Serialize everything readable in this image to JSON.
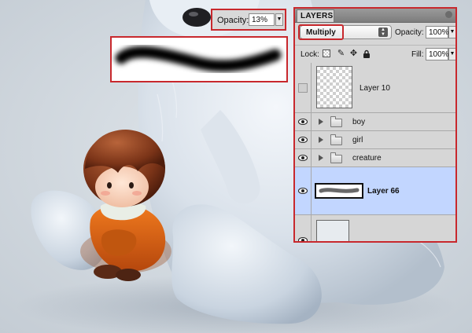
{
  "tool_options": {
    "opacity_label": "Opacity:",
    "opacity_value": "13%"
  },
  "layers_panel": {
    "tab_label": "LAYERS",
    "blend_mode": "Multiply",
    "opacity_label": "Opacity:",
    "opacity_value": "100%",
    "lock_label": "Lock:",
    "fill_label": "Fill:",
    "fill_value": "100%",
    "layers": [
      {
        "name": "Layer 10",
        "type": "layer",
        "visible": false
      },
      {
        "name": "boy",
        "type": "group",
        "visible": true
      },
      {
        "name": "girl",
        "type": "group",
        "visible": true
      },
      {
        "name": "creature",
        "type": "group",
        "visible": true
      },
      {
        "name": "Layer 66",
        "type": "layer",
        "visible": true,
        "selected": true
      },
      {
        "name": "",
        "type": "layer",
        "visible": true
      }
    ]
  },
  "colors": {
    "highlight_red": "#c8282d",
    "selected_row": "#c2d6ff"
  },
  "icons": [
    "eye-icon",
    "folder-icon",
    "disclosure-triangle-icon",
    "lock-transparent-icon",
    "lock-image-icon",
    "lock-position-icon",
    "lock-all-icon"
  ]
}
